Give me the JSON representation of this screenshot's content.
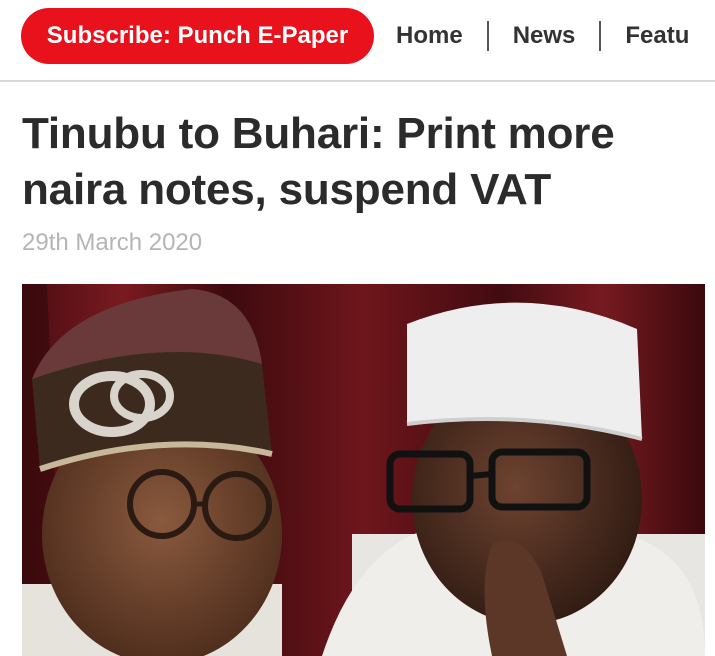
{
  "header": {
    "subscribe_label": "Subscribe: Punch E-Paper",
    "nav_items": [
      "Home",
      "News",
      "Featu"
    ]
  },
  "article": {
    "title": "Tinubu to Buhari: Print more naira notes, suspend VAT",
    "date": "29th March 2020"
  },
  "colors": {
    "brand_red": "#e8111c",
    "nav_text": "#333333",
    "date_text": "#b5b5b5"
  }
}
